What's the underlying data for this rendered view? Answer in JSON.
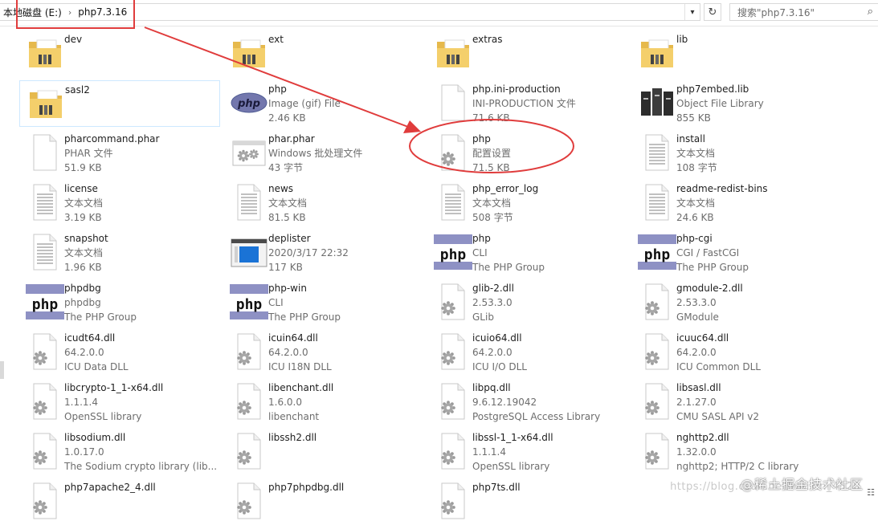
{
  "address": {
    "crumbs": [
      "本地磁盘 (E:)",
      "php7.3.16"
    ],
    "search_placeholder": "搜索\"php7.3.16\""
  },
  "watermark": {
    "main": "@稀土掘金技术社区",
    "sub": "https://blog.csdn.net/weixin_4520"
  },
  "colors": {
    "annotation": "#e03c3c",
    "selection": "#cde8ff",
    "meta_text": "#6d6d6d"
  },
  "items": [
    {
      "name": "dev",
      "sub": [],
      "icon": "folder"
    },
    {
      "name": "ext",
      "sub": [],
      "icon": "folder"
    },
    {
      "name": "extras",
      "sub": [],
      "icon": "folder"
    },
    {
      "name": "lib",
      "sub": [],
      "icon": "folder"
    },
    {
      "name": "sasl2",
      "sub": [],
      "icon": "folder",
      "selected": true
    },
    {
      "name": "php",
      "sub": [
        "Image (gif) File",
        "2.46 KB"
      ],
      "icon": "php-oval"
    },
    {
      "name": "php.ini-production",
      "sub": [
        "INI-PRODUCTION 文件",
        "71.6 KB"
      ],
      "icon": "blank"
    },
    {
      "name": "php7embed.lib",
      "sub": [
        "Object File Library",
        "855 KB"
      ],
      "icon": "library"
    },
    {
      "name": "pharcommand.phar",
      "sub": [
        "PHAR 文件",
        "51.9 KB"
      ],
      "icon": "blank"
    },
    {
      "name": "phar.phar",
      "sub": [
        "Windows 批处理文件",
        "43 字节"
      ],
      "icon": "gear-window"
    },
    {
      "name": "php",
      "sub": [
        "配置设置",
        "71.5 KB"
      ],
      "icon": "gear-doc"
    },
    {
      "name": "install",
      "sub": [
        "文本文档",
        "108 字节"
      ],
      "icon": "text"
    },
    {
      "name": "license",
      "sub": [
        "文本文档",
        "3.19 KB"
      ],
      "icon": "text"
    },
    {
      "name": "news",
      "sub": [
        "文本文档",
        "81.5 KB"
      ],
      "icon": "text"
    },
    {
      "name": "php_error_log",
      "sub": [
        "文本文档",
        "508 字节"
      ],
      "icon": "text"
    },
    {
      "name": "readme-redist-bins",
      "sub": [
        "文本文档",
        "24.6 KB"
      ],
      "icon": "text"
    },
    {
      "name": "snapshot",
      "sub": [
        "文本文档",
        "1.96 KB"
      ],
      "icon": "text"
    },
    {
      "name": "deplister",
      "sub": [
        "2020/3/17 22:32",
        "117 KB"
      ],
      "icon": "exe-window"
    },
    {
      "name": "php",
      "sub": [
        "CLI",
        "The PHP Group"
      ],
      "icon": "php-tile"
    },
    {
      "name": "php-cgi",
      "sub": [
        "CGI / FastCGI",
        "The PHP Group"
      ],
      "icon": "php-tile"
    },
    {
      "name": "phpdbg",
      "sub": [
        "phpdbg",
        "The PHP Group"
      ],
      "icon": "php-tile"
    },
    {
      "name": "php-win",
      "sub": [
        "CLI",
        "The PHP Group"
      ],
      "icon": "php-tile"
    },
    {
      "name": "glib-2.dll",
      "sub": [
        "2.53.3.0",
        "GLib"
      ],
      "icon": "gear-doc"
    },
    {
      "name": "gmodule-2.dll",
      "sub": [
        "2.53.3.0",
        "GModule"
      ],
      "icon": "gear-doc"
    },
    {
      "name": "icudt64.dll",
      "sub": [
        "64.2.0.0",
        "ICU Data DLL"
      ],
      "icon": "gear-doc"
    },
    {
      "name": "icuin64.dll",
      "sub": [
        "64.2.0.0",
        "ICU I18N DLL"
      ],
      "icon": "gear-doc"
    },
    {
      "name": "icuio64.dll",
      "sub": [
        "64.2.0.0",
        "ICU I/O DLL"
      ],
      "icon": "gear-doc"
    },
    {
      "name": "icuuc64.dll",
      "sub": [
        "64.2.0.0",
        "ICU Common DLL"
      ],
      "icon": "gear-doc"
    },
    {
      "name": "libcrypto-1_1-x64.dll",
      "sub": [
        "1.1.1.4",
        "OpenSSL library"
      ],
      "icon": "gear-doc"
    },
    {
      "name": "libenchant.dll",
      "sub": [
        "1.6.0.0",
        "libenchant"
      ],
      "icon": "gear-doc"
    },
    {
      "name": "libpq.dll",
      "sub": [
        "9.6.12.19042",
        "PostgreSQL Access Library"
      ],
      "icon": "gear-doc"
    },
    {
      "name": "libsasl.dll",
      "sub": [
        "2.1.27.0",
        "CMU SASL API v2"
      ],
      "icon": "gear-doc"
    },
    {
      "name": "libsodium.dll",
      "sub": [
        "1.0.17.0",
        "The Sodium crypto library (lib..."
      ],
      "icon": "gear-doc"
    },
    {
      "name": "libssh2.dll",
      "sub": [],
      "icon": "gear-doc"
    },
    {
      "name": "libssl-1_1-x64.dll",
      "sub": [
        "1.1.1.4",
        "OpenSSL library"
      ],
      "icon": "gear-doc"
    },
    {
      "name": "nghttp2.dll",
      "sub": [
        "1.32.0.0",
        "nghttp2; HTTP/2 C library"
      ],
      "icon": "gear-doc"
    },
    {
      "name": "php7apache2_4.dll",
      "sub": [],
      "icon": "gear-doc"
    },
    {
      "name": "php7phpdbg.dll",
      "sub": [],
      "icon": "gear-doc"
    },
    {
      "name": "php7ts.dll",
      "sub": [],
      "icon": "gear-doc"
    },
    {
      "name": "",
      "sub": [],
      "icon": "none"
    }
  ]
}
